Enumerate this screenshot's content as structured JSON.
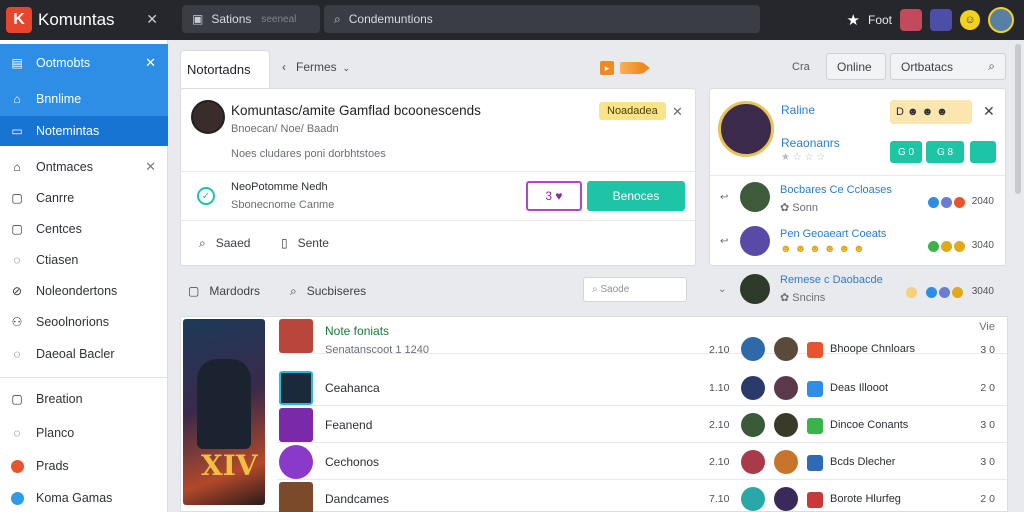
{
  "app": {
    "name": "Komuntas",
    "logo_letter": "K",
    "close_icon": "close-icon",
    "accent": "#1874d2",
    "brand_color": "#e8462c",
    "success_color": "#1ec4a6"
  },
  "topbar": {
    "pill1_label": "Sations",
    "pill1_hint": "seeneal",
    "search_placeholder": "Condemuntions",
    "right_label": "Foot"
  },
  "sidebar": {
    "items": [
      {
        "label": "Ootmobts",
        "icon": "grid-icon"
      },
      {
        "label": "Bnnlime",
        "icon": "home-icon"
      },
      {
        "label": "Notemintas",
        "icon": "card-icon"
      },
      {
        "label": "Ontmaces",
        "icon": "home-outline-icon"
      },
      {
        "label": "Canrre",
        "icon": "square-icon"
      },
      {
        "label": "Centces",
        "icon": "square-icon"
      },
      {
        "label": "Ctiasen",
        "icon": "leaf-icon"
      },
      {
        "label": "Noleondertons",
        "icon": "link-icon"
      },
      {
        "label": "Seoolnorions",
        "icon": "people-icon"
      },
      {
        "label": "Daeoal Bacler",
        "icon": "leaf-icon"
      },
      {
        "label": "Breation",
        "icon": "square-icon"
      },
      {
        "label": "Planco",
        "icon": "leaf-icon"
      },
      {
        "label": "Prads",
        "icon": "orange-dot-icon"
      },
      {
        "label": "Koma Gamas",
        "icon": "blue-dot-icon"
      }
    ]
  },
  "header": {
    "active_tab": "Notortadns",
    "forms_label": "Fermes",
    "status_text": "Cra",
    "online_button": "Online",
    "search_button": "Ortbatacs"
  },
  "post": {
    "title": "Komuntasc/amite Gamflad bcoonescends",
    "subtitle": "Bnoecan/ Noe/ Baadn",
    "meta": "Noes cludares poni dorbhtstoes",
    "badge": "Noadadea",
    "check_title": "NeoPotomme Nedh",
    "check_sub": "Sbonecnome Canme",
    "check_icons": "3 ♥",
    "action_button": "Benoces",
    "foot_search": "Saaed",
    "foot_sense": "Sente"
  },
  "profile": {
    "title": "Raline",
    "subtitle": "Reaonanrs",
    "stars": "★ ☆ ☆ ☆",
    "badges": "D ☻ ☻ ☻",
    "chips": [
      "G 0",
      "G 8"
    ],
    "rows": [
      {
        "title": "Bocbares Ce Ccloases",
        "sub": "✿ Sonn",
        "time": "2040"
      },
      {
        "title": "Pen Geoaeart Coeats",
        "sub": "☻ ☻ ☻ ☻ ☻ ☻",
        "time": "3040"
      },
      {
        "title": "Remese c Daobacde",
        "sub": "✿ Sncins",
        "time": "3040"
      }
    ]
  },
  "toolbar": {
    "mentors": "Mardodrs",
    "searches": "Sucbiseres",
    "search_placeholder": "Saode"
  },
  "table": {
    "header_label": "Note foniats",
    "header_sub": "Senatanscoot 1 1240",
    "col_right": "Vie",
    "rows": [
      {
        "name": "Ceahanca",
        "num": "1.10",
        "game": "Deas Illooot",
        "score": "2 0"
      },
      {
        "name": "Feanend",
        "num": "2.10",
        "game": "Dincoe Conants",
        "score": "3 0"
      },
      {
        "name": "Cechonos",
        "num": "2.10",
        "game": "Bcds Dlecher",
        "score": "3 0"
      },
      {
        "name": "Dandcames",
        "num": "7.10",
        "game": "Borote Hlurfeg",
        "score": "2 0"
      }
    ],
    "first_row": {
      "num": "2.10",
      "game": "Bhoope Chnloars",
      "score": "3 0"
    }
  },
  "feature_art_text": "XIV"
}
